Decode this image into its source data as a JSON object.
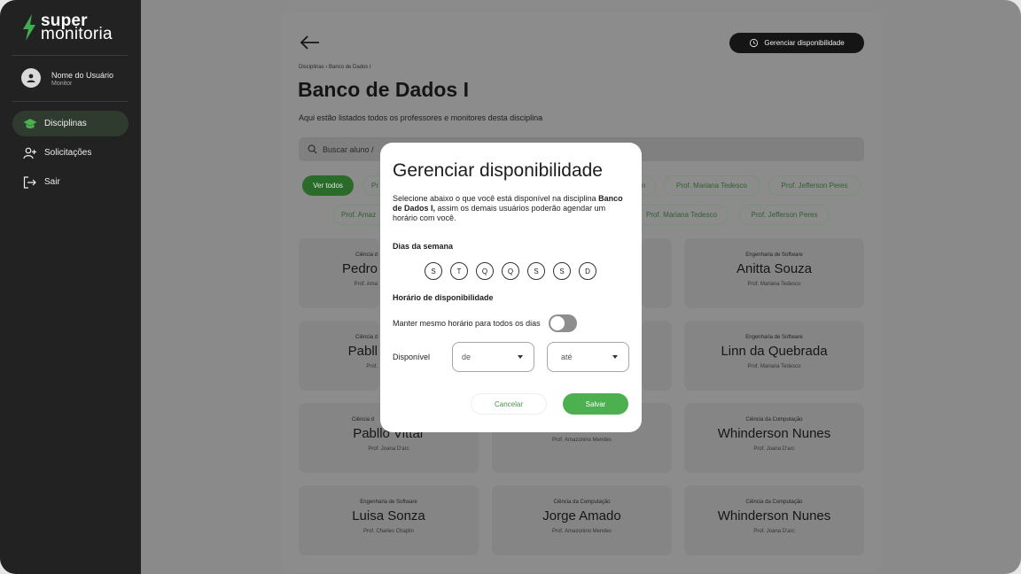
{
  "sidebar": {
    "logo_line1": "super",
    "logo_line2": "monitoria",
    "user_name": "Nome do Usuário",
    "user_role": "Monitor",
    "items": [
      {
        "label": "Disciplinas",
        "icon": "graduation-cap-icon",
        "active": true
      },
      {
        "label": "Solicitações",
        "icon": "add-user-icon",
        "active": false
      },
      {
        "label": "Sair",
        "icon": "logout-icon",
        "active": false
      }
    ]
  },
  "header": {
    "manage_button": "Gerenciar disponibilidade",
    "breadcrumb": "Disciplinas  ›  Banco de Dados I",
    "title": "Banco de Dados I",
    "subtitle": "Aqui estão listados todos os professores e monitores desta disciplina",
    "search_placeholder": "Buscar aluno /"
  },
  "filters": {
    "row1": [
      "Ver todos",
      "Pr",
      "n",
      "Prof. Mariana Tedesco",
      "Prof. Jefferson Peres"
    ],
    "row2": [
      "Prof. Amaz",
      "Prof. Mariana Tedesco",
      "Prof. Jefferson Peres"
    ]
  },
  "cards": [
    {
      "category": "Ciência d",
      "name": "Pedro",
      "prof": "Prof. Ama"
    },
    {
      "category": "Engenharia de Software",
      "name": "Anitta Souza",
      "prof": "Prof. Mariana Tedesco"
    },
    {
      "category": "Ciência d",
      "name": "Pabll",
      "prof": "Prof."
    },
    {
      "category": "Engenharia de Software",
      "name": "Linn da Quebrada",
      "prof": "Prof. Mariana Tedesco"
    },
    {
      "category": "Ciência d",
      "name": "Pabllo Vittar",
      "prof": "Prof. Joana D'arc"
    },
    {
      "category": "",
      "name": "Jorge Amado",
      "prof": "Prof. Amazonino Mendes"
    },
    {
      "category": "Ciência da Computação",
      "name": "Whinderson Nunes",
      "prof": "Prof. Joana D'arc"
    },
    {
      "category": "Engenharia de Software",
      "name": "Luisa Sonza",
      "prof": "Prof. Charles Chaplin"
    },
    {
      "category": "Ciência da Computação",
      "name": "Jorge Amado",
      "prof": "Prof. Amazonino Mendes"
    },
    {
      "category": "Ciência da Computação",
      "name": "Whinderson Nunes",
      "prof": "Prof. Joana D'arc"
    }
  ],
  "modal": {
    "title": "Gerenciar disponibilidade",
    "desc_part1": "Selecione abaixo o  que você está disponível na disciplina ",
    "desc_bold": "Banco de Dados I,",
    "desc_part2": " assim os demais usuários poderão agendar um horário com você.",
    "days_label": "Dias da semana",
    "days": [
      "S",
      "T",
      "Q",
      "Q",
      "S",
      "S",
      "D"
    ],
    "hours_label": "Horário de disponibilidade",
    "same_hours_label": "Manter mesmo horário para todos os dias",
    "same_hours_on": false,
    "available_label": "Disponível",
    "from_placeholder": "de",
    "to_placeholder": "até",
    "cancel": "Cancelar",
    "save": "Salvar"
  },
  "colors": {
    "accent": "#4caf50",
    "sidebar": "#222222",
    "overlay": "#8c8c8c"
  }
}
